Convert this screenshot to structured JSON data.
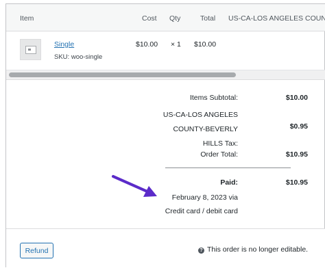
{
  "table": {
    "headers": {
      "item": "Item",
      "cost": "Cost",
      "qty": "Qty",
      "total": "Total",
      "tax": "US-CA-LOS ANGELES COUNT"
    },
    "rows": [
      {
        "name": "Single",
        "sku_label": "SKU:",
        "sku": "woo-single",
        "cost": "$10.00",
        "qty": "× 1",
        "total": "$10.00"
      }
    ]
  },
  "totals": {
    "items_subtotal_label": "Items Subtotal:",
    "items_subtotal_value": "$10.00",
    "tax_label_lines": [
      "US-CA-LOS ANGELES",
      "COUNTY-BEVERLY",
      "HILLS Tax:"
    ],
    "tax_value": "$0.95",
    "order_total_label": "Order Total:",
    "order_total_value": "$10.95",
    "paid_label": "Paid:",
    "paid_value": "$10.95",
    "paid_date": "February 8, 2023 via",
    "paid_method": "Credit card / debit card"
  },
  "footer": {
    "refund_label": "Refund",
    "notice": "This order is no longer editable."
  },
  "colors": {
    "link": "#2271b1",
    "arrow": "#5b2bc9",
    "border": "#c3c4c7"
  },
  "icons": {
    "product": "product-thumbnail",
    "help": "question-circle-icon",
    "arrow": "annotation-arrow"
  }
}
